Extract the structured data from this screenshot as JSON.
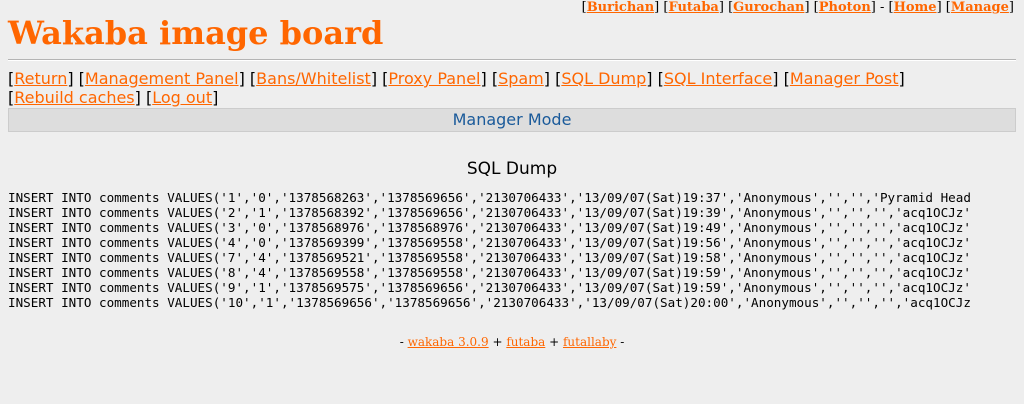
{
  "style_links": [
    "Burichan",
    "Futaba",
    "Gurochan",
    "Photon"
  ],
  "nav_links": [
    "Home",
    "Manage"
  ],
  "title": "Wakaba image board",
  "admin_links": [
    "Return",
    "Management Panel",
    "Bans/Whitelist",
    "Proxy Panel",
    "Spam",
    "SQL Dump",
    "SQL Interface",
    "Manager Post",
    "Rebuild caches",
    "Log out"
  ],
  "mode_banner": "Manager Mode",
  "section_title": "SQL Dump",
  "dump_lines": [
    "INSERT INTO comments VALUES('1','0','1378568263','1378569656','2130706433','13/09/07(Sat)19:37','Anonymous','','','Pyramid Head",
    "INSERT INTO comments VALUES('2','1','1378568392','1378569656','2130706433','13/09/07(Sat)19:39','Anonymous','','','','acq1OCJz'",
    "INSERT INTO comments VALUES('3','0','1378568976','1378568976','2130706433','13/09/07(Sat)19:49','Anonymous','','','','acq1OCJz'",
    "INSERT INTO comments VALUES('4','0','1378569399','1378569558','2130706433','13/09/07(Sat)19:56','Anonymous','','','','acq1OCJz'",
    "INSERT INTO comments VALUES('7','4','1378569521','1378569558','2130706433','13/09/07(Sat)19:58','Anonymous','','','','acq1OCJz'",
    "INSERT INTO comments VALUES('8','4','1378569558','1378569558','2130706433','13/09/07(Sat)19:59','Anonymous','','','','acq1OCJz'",
    "INSERT INTO comments VALUES('9','1','1378569575','1378569656','2130706433','13/09/07(Sat)19:59','Anonymous','','','','acq1OCJz'",
    "INSERT INTO comments VALUES('10','1','1378569656','1378569656','2130706433','13/09/07(Sat)20:00','Anonymous','','','','acq1OCJz"
  ],
  "footer": {
    "prefix": "- ",
    "links": [
      "wakaba 3.0.9",
      "futaba",
      "futallaby"
    ],
    "sep": " + ",
    "suffix": " -"
  }
}
